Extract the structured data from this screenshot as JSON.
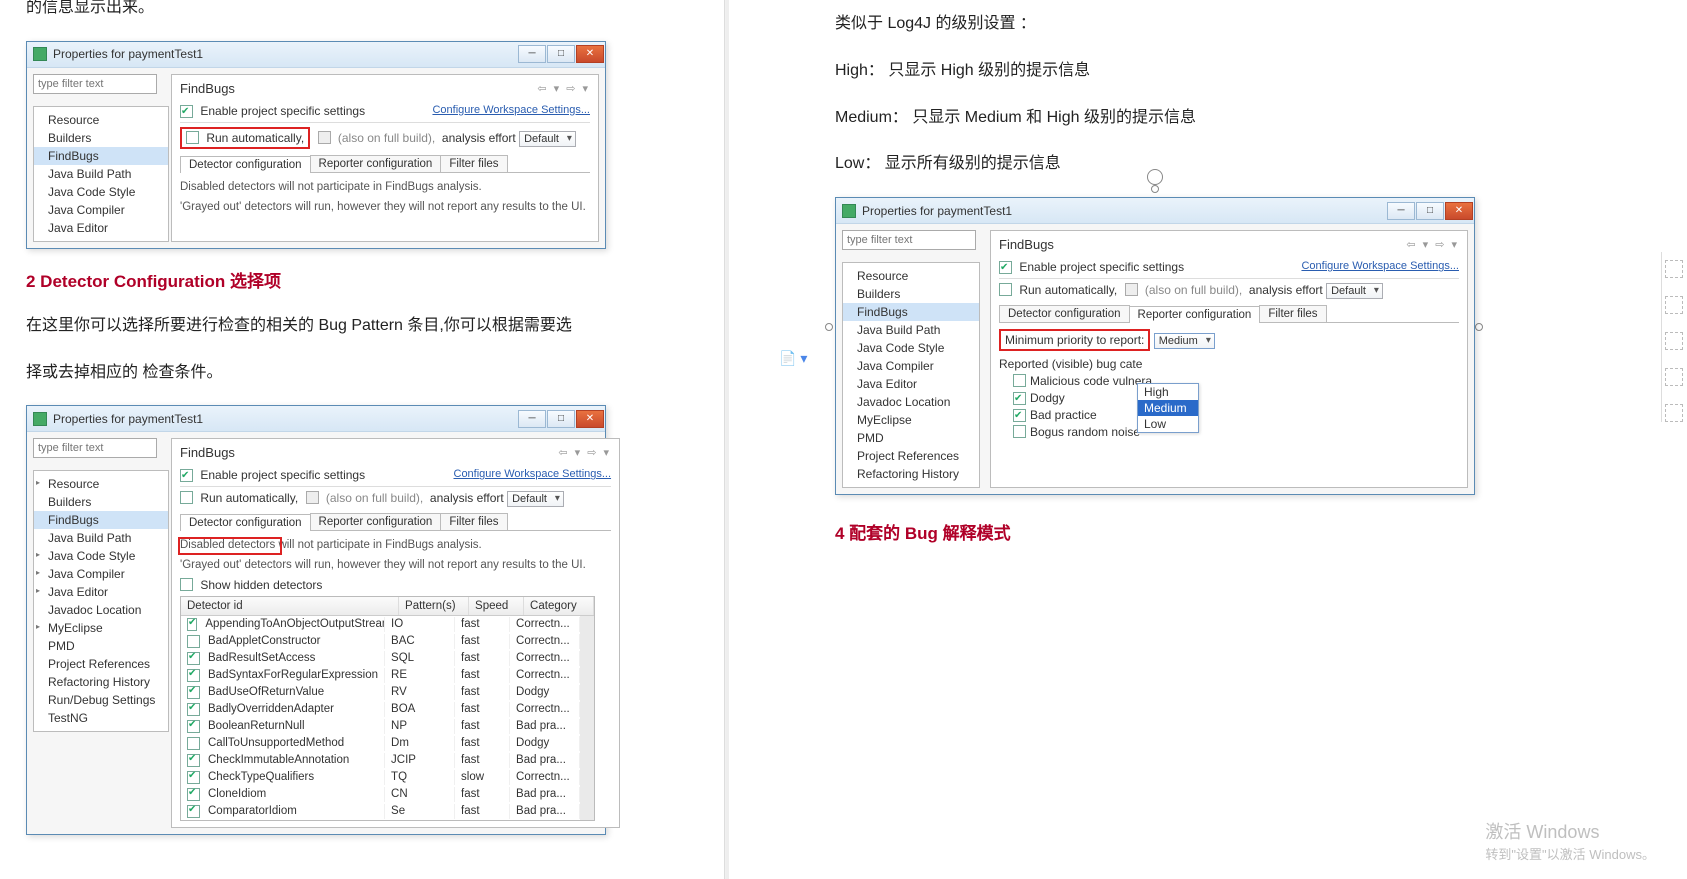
{
  "left": {
    "topFragment": "的信息显示出来。",
    "heading2": "2 Detector Configuration 选择项",
    "para2a": "在这里你可以选择所要进行检查的相关的 Bug Pattern 条目,你可以根据需要选",
    "para2b": "择或去掉相应的 检查条件。"
  },
  "right": {
    "para1": "类似于 Log4J 的级别设置 ：",
    "line_high": "High：  只显示 High 级别的提示信息",
    "line_medium": "Medium： 只显示 Medium 和 High 级别的提示信息",
    "line_low": "Low： 显示所有级别的提示信息",
    "heading4": "4  配套的 Bug 解释模式"
  },
  "dlg1": {
    "title": "Properties for paymentTest1",
    "filter_placeholder": "type filter text",
    "nav": [
      "Resource",
      "Builders",
      "FindBugs",
      "Java Build Path",
      "Java Code Style",
      "Java Compiler",
      "Java Editor"
    ],
    "nav_selected_index": 2,
    "heading": "FindBugs",
    "enable_label": "Enable project specific settings",
    "conf_link": "Configure Workspace Settings...",
    "run_auto": "Run automatically,",
    "also_full": "(also on full build),",
    "effort_label": "analysis effort",
    "effort_value": "Default",
    "tabs": [
      "Detector configuration",
      "Reporter configuration",
      "Filter files"
    ],
    "active_tab_index": 0,
    "help1": "Disabled detectors will not participate in FindBugs analysis.",
    "help2": "'Grayed out' detectors will run, however they will not report any results to the UI."
  },
  "dlg2": {
    "title": "Properties for paymentTest1",
    "filter_placeholder": "type filter text",
    "nav": [
      "Resource",
      "Builders",
      "FindBugs",
      "Java Build Path",
      "Java Code Style",
      "Java Compiler",
      "Java Editor",
      "Javadoc Location",
      "MyEclipse",
      "PMD",
      "Project References",
      "Refactoring History",
      "Run/Debug Settings",
      "TestNG"
    ],
    "nav_exp": [
      0,
      4,
      5,
      6,
      8
    ],
    "nav_selected_index": 2,
    "heading": "FindBugs",
    "enable_label": "Enable project specific settings",
    "conf_link": "Configure Workspace Settings...",
    "run_auto": "Run automatically,",
    "also_full": "(also on full build),",
    "effort_label": "analysis effort",
    "effort_value": "Default",
    "tabs": [
      "Detector configuration",
      "Reporter configuration",
      "Filter files"
    ],
    "active_tab_index": 0,
    "help1": "Disabled detectors will not participate in FindBugs analysis.",
    "help2": "'Grayed out' detectors will run, however they will not report any results to the UI.",
    "show_hidden": "Show hidden detectors",
    "columns": {
      "id": "Detector id",
      "pattern": "Pattern(s)",
      "speed": "Speed",
      "category": "Category"
    },
    "rows": [
      {
        "on": true,
        "id": "AppendingToAnObjectOutputStream",
        "pat": "IO",
        "spd": "fast",
        "cat": "Correctn..."
      },
      {
        "on": false,
        "id": "BadAppletConstructor",
        "pat": "BAC",
        "spd": "fast",
        "cat": "Correctn..."
      },
      {
        "on": true,
        "id": "BadResultSetAccess",
        "pat": "SQL",
        "spd": "fast",
        "cat": "Correctn..."
      },
      {
        "on": true,
        "id": "BadSyntaxForRegularExpression",
        "pat": "RE",
        "spd": "fast",
        "cat": "Correctn..."
      },
      {
        "on": true,
        "id": "BadUseOfReturnValue",
        "pat": "RV",
        "spd": "fast",
        "cat": "Dodgy"
      },
      {
        "on": true,
        "id": "BadlyOverriddenAdapter",
        "pat": "BOA",
        "spd": "fast",
        "cat": "Correctn..."
      },
      {
        "on": true,
        "id": "BooleanReturnNull",
        "pat": "NP",
        "spd": "fast",
        "cat": "Bad pra..."
      },
      {
        "on": false,
        "id": "CallToUnsupportedMethod",
        "pat": "Dm",
        "spd": "fast",
        "cat": "Dodgy"
      },
      {
        "on": true,
        "id": "CheckImmutableAnnotation",
        "pat": "JCIP",
        "spd": "fast",
        "cat": "Bad pra..."
      },
      {
        "on": true,
        "id": "CheckTypeQualifiers",
        "pat": "TQ",
        "spd": "slow",
        "cat": "Correctn..."
      },
      {
        "on": true,
        "id": "CloneIdiom",
        "pat": "CN",
        "spd": "fast",
        "cat": "Bad pra..."
      },
      {
        "on": true,
        "id": "ComparatorIdiom",
        "pat": "Se",
        "spd": "fast",
        "cat": "Bad pra..."
      }
    ]
  },
  "dlg3": {
    "title": "Properties for paymentTest1",
    "filter_placeholder": "type filter text",
    "nav": [
      "Resource",
      "Builders",
      "FindBugs",
      "Java Build Path",
      "Java Code Style",
      "Java Compiler",
      "Java Editor",
      "Javadoc Location",
      "MyEclipse",
      "PMD",
      "Project References",
      "Refactoring History"
    ],
    "nav_selected_index": 2,
    "heading": "FindBugs",
    "enable_label": "Enable project specific settings",
    "conf_link": "Configure Workspace Settings...",
    "run_auto": "Run automatically,",
    "also_full": "(also on full build),",
    "effort_label": "analysis effort",
    "effort_value": "Default",
    "tabs": [
      "Detector configuration",
      "Reporter configuration",
      "Filter files"
    ],
    "active_tab_index": 1,
    "min_prio_label": "Minimum priority to report:",
    "min_prio_value": "Medium",
    "dropdown_options": [
      "High",
      "Medium",
      "Low"
    ],
    "dropdown_selected_index": 1,
    "reported_label": "Reported (visible) bug cate",
    "cats": [
      {
        "on": false,
        "label": "Malicious code vulnera"
      },
      {
        "on": true,
        "label": "Dodgy"
      },
      {
        "on": true,
        "label": "Bad practice"
      },
      {
        "on": false,
        "label": "Bogus random noise"
      }
    ]
  },
  "watermark": {
    "line1": "激活 Windows",
    "line2": "转到\"设置\"以激活 Windows。"
  }
}
